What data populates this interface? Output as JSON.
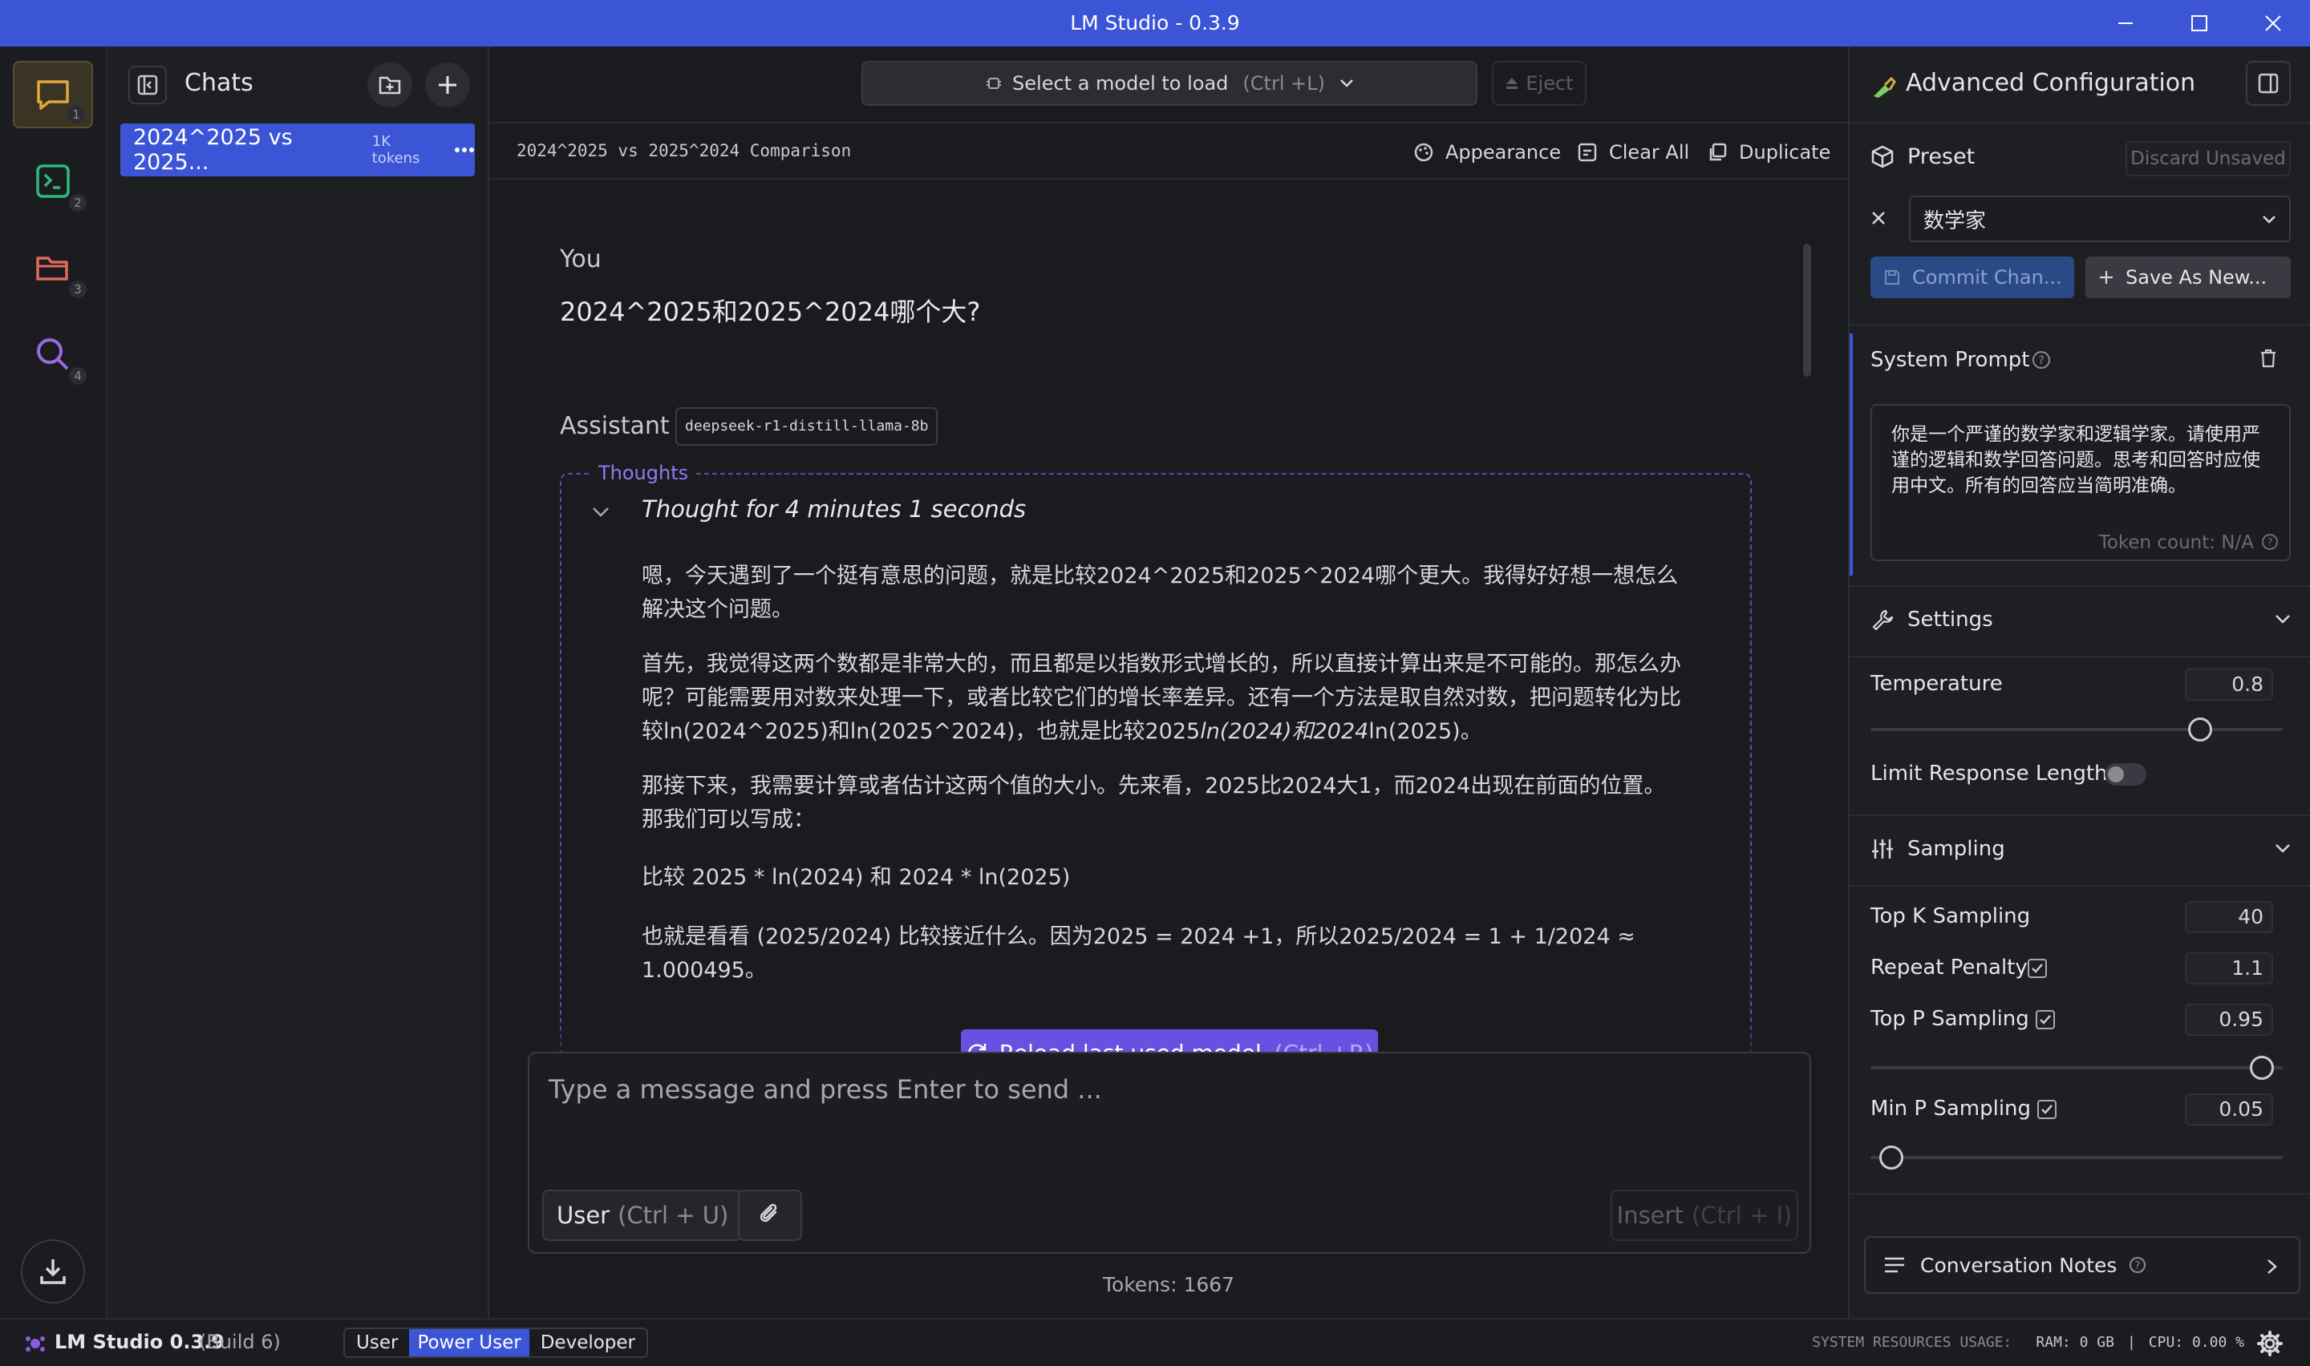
{
  "window": {
    "title": "LM Studio - 0.3.9"
  },
  "rail": {
    "items": [
      {
        "num": "1",
        "icon": "chat-bubble-icon"
      },
      {
        "num": "2",
        "icon": "terminal-icon"
      },
      {
        "num": "3",
        "icon": "folder-icon"
      },
      {
        "num": "4",
        "icon": "search-icon"
      }
    ]
  },
  "chats": {
    "title": "Chats",
    "items": [
      {
        "name": "2024^2025 vs 2025...",
        "tokens": "1K tokens"
      }
    ]
  },
  "topbar": {
    "model_select": "Select a model to load",
    "model_shortcut": "(Ctrl +L)",
    "eject": "Eject"
  },
  "chat_header": {
    "title": "2024^2025 vs 2025^2024 Comparison",
    "appearance": "Appearance",
    "clear_all": "Clear All",
    "duplicate": "Duplicate"
  },
  "conversation": {
    "user_label": "You",
    "user_message": "2024^2025和2025^2024哪个大?",
    "assistant_label": "Assistant",
    "model_tag": "deepseek-r1-distill-llama-8b",
    "thoughts_label": "Thoughts",
    "thought_time": "Thought for 4 minutes 1 seconds",
    "p1": "嗯，今天遇到了一个挺有意思的问题，就是比较2024^2025和2025^2024哪个更大。我得好好想一想怎么解决这个问题。",
    "p2a": "首先，我觉得这两个数都是非常大的，而且都是以指数形式增长的，所以直接计算出来是不可能的。那怎么办呢？可能需要用对数来处理一下，或者比较它们的增长率差异。还有一个方法是取自然对数，把问题转化为比较ln(2024^2025)和ln(2025^2024)，也就是比较2025",
    "p2b": "ln(2024)和2024",
    "p2c": "ln(2025)。",
    "p3": "那接下来，我需要计算或者估计这两个值的大小。先来看，2025比2024大1，而2024出现在前面的位置。那我们可以写成：",
    "p4": "比较 2025 * ln(2024) 和 2024 * ln(2025)",
    "p5": "也就是看看 (2025/2024) 比较接近什么。因为2025 = 2024 +1，所以2025/2024 = 1 + 1/2024 ≈ 1.000495。",
    "reload": "Reload last used model",
    "reload_shortcut": "(Ctrl +R)"
  },
  "composer": {
    "placeholder": "Type a message and press Enter to send ...",
    "role_label": "User",
    "role_shortcut": "(Ctrl + U)",
    "insert": "Insert",
    "insert_shortcut": "(Ctrl + I)",
    "tokens": "Tokens: 1667"
  },
  "config": {
    "title": "Advanced Configuration",
    "preset_label": "Preset",
    "discard": "Discard Unsaved",
    "preset_value": "数学家",
    "commit": "Commit Chan...",
    "save_as_new": "Save As New...",
    "system_prompt_label": "System Prompt",
    "system_prompt": "你是一个严谨的数学家和逻辑学家。请使用严谨的逻辑和数学回答问题。思考和回答时应使用中文。所有的回答应当简明准确。",
    "token_count": "Token count: N/A",
    "settings_label": "Settings",
    "temperature_label": "Temperature",
    "temperature": "0.8",
    "temperature_level": 0.8,
    "limit_label": "Limit Response Length",
    "limit_on": false,
    "sampling_label": "Sampling",
    "topk_label": "Top K Sampling",
    "topk": "40",
    "repeat_label": "Repeat Penalty",
    "repeat": "1.1",
    "topp_label": "Top P Sampling",
    "topp": "0.95",
    "topp_level": 0.95,
    "minp_label": "Min P Sampling",
    "minp": "0.05",
    "minp_level": 0.05,
    "notes_label": "Conversation Notes"
  },
  "statusbar": {
    "app": "LM Studio 0.3.9",
    "build": "(Build 6)",
    "modes": [
      "User",
      "Power User",
      "Developer"
    ],
    "active_mode": "Power User",
    "resources_label": "SYSTEM RESOURCES USAGE:",
    "ram": "RAM: 0 GB",
    "cpu": "CPU: 0.00 %"
  },
  "colors": {
    "accent": "#3c55d6",
    "purple": "#6b4fe0",
    "rail_active": "#d9a441"
  }
}
